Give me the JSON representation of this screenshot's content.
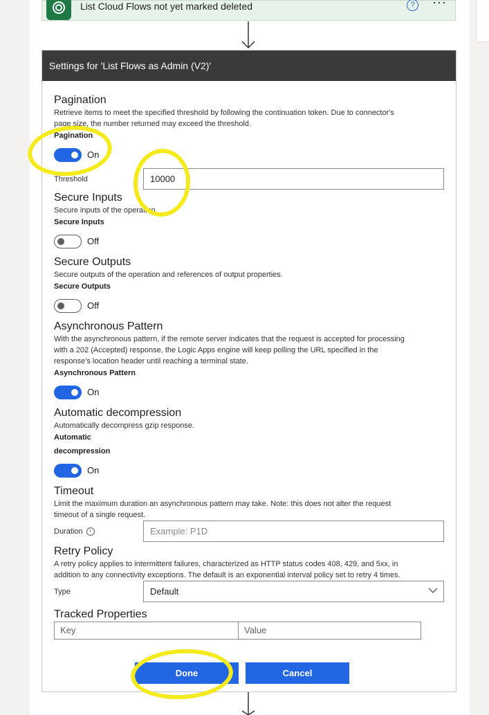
{
  "trigger": {
    "title": "List Cloud Flows not yet marked deleted",
    "help_glyph": "?",
    "more_glyph": "···"
  },
  "settings": {
    "header": "Settings for 'List Flows as Admin (V2)'",
    "pagination": {
      "title": "Pagination",
      "desc1": "Retrieve items to meet the specified threshold by following the continuation token. Due to connector's",
      "desc2": "page size, the number returned may exceed the threshold.",
      "label": "Pagination",
      "state": "On",
      "threshold_label": "Threshold",
      "threshold_value": "10000"
    },
    "secure_inputs": {
      "title": "Secure Inputs",
      "desc": "Secure inputs of the operation.",
      "label": "Secure Inputs",
      "state": "Off"
    },
    "secure_outputs": {
      "title": "Secure Outputs",
      "desc": "Secure outputs of the operation and references of output properties.",
      "label": "Secure Outputs",
      "state": "Off"
    },
    "async": {
      "title": "Asynchronous Pattern",
      "desc1": "With the asynchronous pattern, if the remote server indicates that the request is accepted for processing",
      "desc2": "with a 202 (Accepted) response, the Logic Apps engine will keep polling the URL specified in the",
      "desc3": "response's location header until reaching a terminal state.",
      "label": "Asynchronous Pattern",
      "state": "On"
    },
    "decompression": {
      "title": "Automatic decompression",
      "desc": "Automatically decompress gzip response.",
      "label1": "Automatic",
      "label2": "decompression",
      "state": "On"
    },
    "timeout": {
      "title": "Timeout",
      "desc1": "Limit the maximum duration an asynchronous pattern may take. Note: this does not alter the request",
      "desc2": "timeout of a single request.",
      "duration_label": "Duration",
      "info_glyph": "i",
      "duration_placeholder": "Example: P1D"
    },
    "retry": {
      "title": "Retry Policy",
      "desc1": "A retry policy applies to intermittent failures, characterized as HTTP status codes 408, 429, and 5xx, in",
      "desc2": "addition to any connectivity exceptions. The default is an exponential interval policy set to retry 4 times.",
      "type_label": "Type",
      "type_value": "Default"
    },
    "tracked": {
      "title": "Tracked Properties",
      "key_placeholder": "Key",
      "value_placeholder": "Value"
    },
    "buttons": {
      "done": "Done",
      "cancel": "Cancel"
    }
  },
  "colors": {
    "accent": "#2266e3",
    "header_bg": "#3b3a39",
    "highlight": "#f5ea1e",
    "trigger_bg": "#e7f2ea"
  }
}
